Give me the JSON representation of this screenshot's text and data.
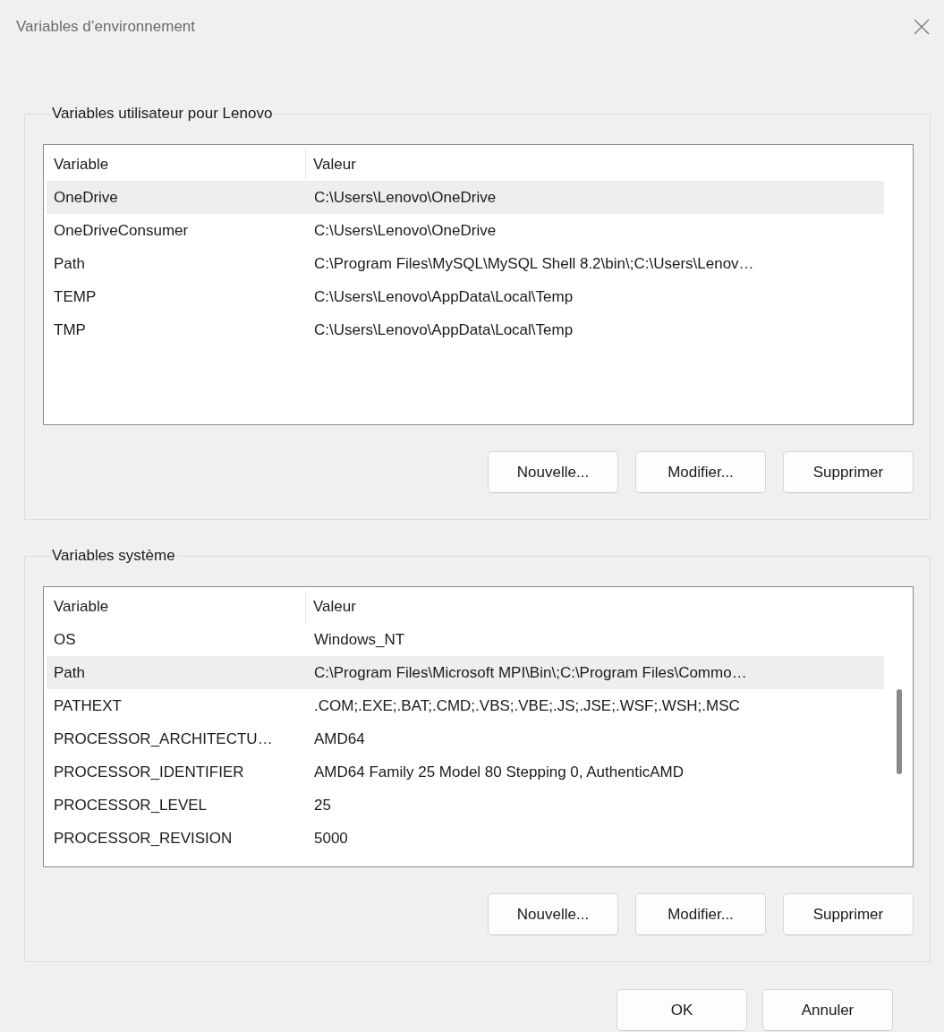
{
  "window": {
    "title": "Variables d’environnement"
  },
  "user_variables": {
    "title": "Variables utilisateur pour Lenovo",
    "columns": [
      "Variable",
      "Valeur"
    ],
    "scrollbar": false,
    "rows": [
      {
        "variable": "OneDrive",
        "value": "C:\\Users\\Lenovo\\OneDrive",
        "selected": true
      },
      {
        "variable": "OneDriveConsumer",
        "value": "C:\\Users\\Lenovo\\OneDrive",
        "selected": false
      },
      {
        "variable": "Path",
        "value": "C:\\Program Files\\MySQL\\MySQL Shell 8.2\\bin\\;C:\\Users\\Lenov…",
        "selected": false
      },
      {
        "variable": "TEMP",
        "value": "C:\\Users\\Lenovo\\AppData\\Local\\Temp",
        "selected": false
      },
      {
        "variable": "TMP",
        "value": "C:\\Users\\Lenovo\\AppData\\Local\\Temp",
        "selected": false
      }
    ],
    "buttons": [
      "Nouvelle...",
      "Modifier...",
      "Supprimer"
    ]
  },
  "system_variables": {
    "title": "Variables système",
    "columns": [
      "Variable",
      "Valeur"
    ],
    "scrollbar": true,
    "rows": [
      {
        "variable": "OS",
        "value": "Windows_NT",
        "selected": false
      },
      {
        "variable": "Path",
        "value": "C:\\Program Files\\Microsoft MPI\\Bin\\;C:\\Program Files\\Commo…",
        "selected": true
      },
      {
        "variable": "PATHEXT",
        "value": ".COM;.EXE;.BAT;.CMD;.VBS;.VBE;.JS;.JSE;.WSF;.WSH;.MSC",
        "selected": false
      },
      {
        "variable": "PROCESSOR_ARCHITECTU…",
        "value": "AMD64",
        "selected": false
      },
      {
        "variable": "PROCESSOR_IDENTIFIER",
        "value": "AMD64 Family 25 Model 80 Stepping 0, AuthenticAMD",
        "selected": false
      },
      {
        "variable": "PROCESSOR_LEVEL",
        "value": "25",
        "selected": false
      },
      {
        "variable": "PROCESSOR_REVISION",
        "value": "5000",
        "selected": false
      }
    ],
    "buttons": [
      "Nouvelle...",
      "Modifier...",
      "Supprimer"
    ]
  },
  "buttons": [
    "OK",
    "Annuler"
  ]
}
